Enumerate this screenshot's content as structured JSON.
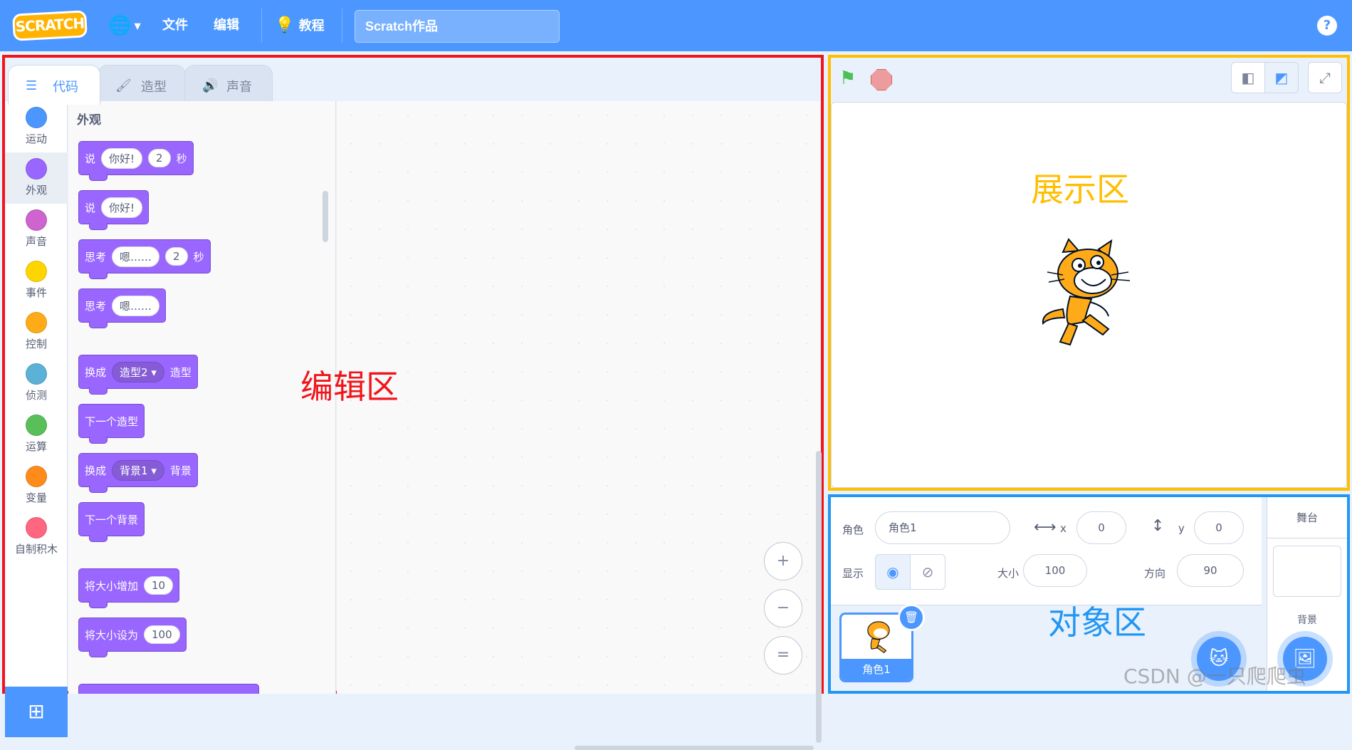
{
  "menubar": {
    "logo": "SCRATCH",
    "file": "文件",
    "edit": "编辑",
    "tutorials": "教程",
    "project_title": "Scratch作品",
    "help": "?"
  },
  "tabs": [
    {
      "label": "代码",
      "icon": "code-icon"
    },
    {
      "label": "造型",
      "icon": "brush-icon"
    },
    {
      "label": "声音",
      "icon": "speaker-icon"
    }
  ],
  "categories": [
    {
      "label": "运动",
      "color": "#4c97ff"
    },
    {
      "label": "外观",
      "color": "#9966ff"
    },
    {
      "label": "声音",
      "color": "#cf63cf"
    },
    {
      "label": "事件",
      "color": "#ffd500"
    },
    {
      "label": "控制",
      "color": "#ffab19"
    },
    {
      "label": "侦测",
      "color": "#5cb1d6"
    },
    {
      "label": "运算",
      "color": "#59c059"
    },
    {
      "label": "变量",
      "color": "#ff8c1a"
    },
    {
      "label": "自制积木",
      "color": "#ff6680"
    }
  ],
  "palette": {
    "heading": "外观",
    "blocks": {
      "say_secs": {
        "say": "说",
        "text": "你好!",
        "secs": "2",
        "unit": "秒"
      },
      "say": {
        "say": "说",
        "text": "你好!"
      },
      "think_secs": {
        "think": "思考",
        "text": "嗯……",
        "secs": "2",
        "unit": "秒"
      },
      "think": {
        "think": "思考",
        "text": "嗯……"
      },
      "switch_costume": {
        "prefix": "换成",
        "value": "造型2",
        "suffix": "造型"
      },
      "next_costume": {
        "label": "下一个造型"
      },
      "switch_backdrop": {
        "prefix": "换成",
        "value": "背景1",
        "suffix": "背景"
      },
      "next_backdrop": {
        "label": "下一个背景"
      },
      "change_size": {
        "label": "将大小增加",
        "value": "10"
      },
      "set_size": {
        "label": "将大小设为",
        "value": "100"
      }
    }
  },
  "zoom": {
    "in": "+",
    "out": "−",
    "reset": "="
  },
  "annotations": {
    "editor": "编辑区",
    "stage": "展示区",
    "objects": "对象区"
  },
  "sprite_info": {
    "sprite_label": "角色",
    "sprite_name": "角色1",
    "x_label": "x",
    "x": "0",
    "y_label": "y",
    "y": "0",
    "show_label": "显示",
    "size_label": "大小",
    "size": "100",
    "direction_label": "方向",
    "direction": "90"
  },
  "sprites": [
    {
      "name": "角色1"
    }
  ],
  "stage_pane": {
    "title": "舞台",
    "backdrops_label": "背景"
  },
  "watermark": "CSDN @一只爬爬虫"
}
